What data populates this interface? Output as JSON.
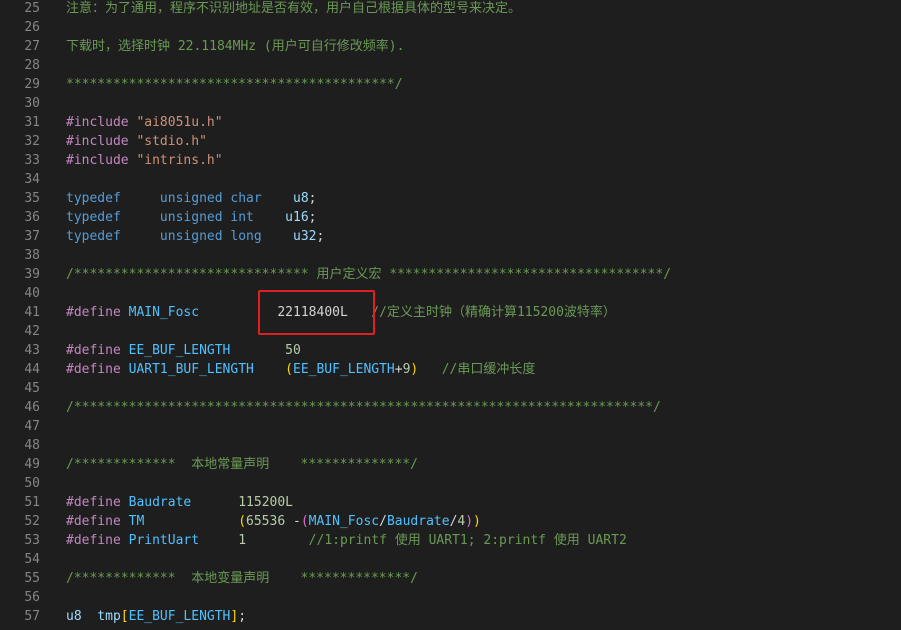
{
  "colors": {
    "background": "#1e1e1e",
    "highlight": "#e02020"
  },
  "lines": [
    {
      "n": "25",
      "tokens": [
        {
          "t": "注意：为了通用，程序不识别地址是否有效，用户自己根据具体的型号来决定。",
          "c": "comment"
        }
      ]
    },
    {
      "n": "26",
      "tokens": []
    },
    {
      "n": "27",
      "tokens": [
        {
          "t": "下载时，选择时钟 22.1184MHz (用户可自行修改频率).",
          "c": "comment"
        }
      ]
    },
    {
      "n": "28",
      "tokens": []
    },
    {
      "n": "29",
      "tokens": [
        {
          "t": "******************************************/",
          "c": "comment"
        }
      ]
    },
    {
      "n": "30",
      "tokens": []
    },
    {
      "n": "31",
      "tokens": [
        {
          "t": "#include",
          "c": "kw"
        },
        {
          "t": " ",
          "c": "plain"
        },
        {
          "t": "\"ai8051u.h\"",
          "c": "str"
        }
      ]
    },
    {
      "n": "32",
      "tokens": [
        {
          "t": "#include",
          "c": "kw"
        },
        {
          "t": " ",
          "c": "plain"
        },
        {
          "t": "\"stdio.h\"",
          "c": "str"
        }
      ]
    },
    {
      "n": "33",
      "tokens": [
        {
          "t": "#include",
          "c": "kw"
        },
        {
          "t": " ",
          "c": "plain"
        },
        {
          "t": "\"intrins.h\"",
          "c": "str"
        }
      ]
    },
    {
      "n": "34",
      "tokens": []
    },
    {
      "n": "35",
      "tokens": [
        {
          "t": "typedef",
          "c": "type"
        },
        {
          "t": "     unsigned char",
          "c": "type"
        },
        {
          "t": "    u8",
          "c": "ident"
        },
        {
          "t": ";",
          "c": "plain"
        }
      ]
    },
    {
      "n": "36",
      "tokens": [
        {
          "t": "typedef",
          "c": "type"
        },
        {
          "t": "     unsigned int",
          "c": "type"
        },
        {
          "t": "    u16",
          "c": "ident"
        },
        {
          "t": ";",
          "c": "plain"
        }
      ]
    },
    {
      "n": "37",
      "tokens": [
        {
          "t": "typedef",
          "c": "type"
        },
        {
          "t": "     unsigned long",
          "c": "type"
        },
        {
          "t": "    u32",
          "c": "ident"
        },
        {
          "t": ";",
          "c": "plain"
        }
      ]
    },
    {
      "n": "38",
      "tokens": []
    },
    {
      "n": "39",
      "tokens": [
        {
          "t": "/****************************** 用户定义宏 ***********************************/",
          "c": "comment"
        }
      ]
    },
    {
      "n": "40",
      "tokens": []
    },
    {
      "n": "41",
      "tokens": [
        {
          "t": "#define",
          "c": "kw"
        },
        {
          "t": " MAIN_Fosc",
          "c": "macro"
        },
        {
          "t": "          ",
          "c": "plain"
        },
        {
          "t": "22118400L",
          "c": "plain"
        },
        {
          "t": "   //定义主时钟（精确计算115200波特率）",
          "c": "comment"
        }
      ]
    },
    {
      "n": "42",
      "tokens": []
    },
    {
      "n": "43",
      "tokens": [
        {
          "t": "#define",
          "c": "kw"
        },
        {
          "t": " EE_BUF_LENGTH",
          "c": "macro"
        },
        {
          "t": "       ",
          "c": "plain"
        },
        {
          "t": "50",
          "c": "num"
        }
      ]
    },
    {
      "n": "44",
      "tokens": [
        {
          "t": "#define",
          "c": "kw"
        },
        {
          "t": " UART1_BUF_LENGTH",
          "c": "macro"
        },
        {
          "t": "    ",
          "c": "plain"
        },
        {
          "t": "(",
          "c": "paren"
        },
        {
          "t": "EE_BUF_LENGTH",
          "c": "macro"
        },
        {
          "t": "+",
          "c": "plain"
        },
        {
          "t": "9",
          "c": "num"
        },
        {
          "t": ")",
          "c": "paren"
        },
        {
          "t": "   //串口缓冲长度",
          "c": "comment"
        }
      ]
    },
    {
      "n": "45",
      "tokens": []
    },
    {
      "n": "46",
      "tokens": [
        {
          "t": "/**************************************************************************/",
          "c": "comment"
        }
      ]
    },
    {
      "n": "47",
      "tokens": []
    },
    {
      "n": "48",
      "tokens": []
    },
    {
      "n": "49",
      "tokens": [
        {
          "t": "/*************  本地常量声明    **************/",
          "c": "comment"
        }
      ]
    },
    {
      "n": "50",
      "tokens": []
    },
    {
      "n": "51",
      "tokens": [
        {
          "t": "#define",
          "c": "kw"
        },
        {
          "t": " Baudrate",
          "c": "macro"
        },
        {
          "t": "      ",
          "c": "plain"
        },
        {
          "t": "115200L",
          "c": "num"
        }
      ]
    },
    {
      "n": "52",
      "tokens": [
        {
          "t": "#define",
          "c": "kw"
        },
        {
          "t": " TM",
          "c": "macro"
        },
        {
          "t": "            ",
          "c": "plain"
        },
        {
          "t": "(",
          "c": "paren"
        },
        {
          "t": "65536",
          "c": "num"
        },
        {
          "t": " -",
          "c": "plain"
        },
        {
          "t": "(",
          "c": "paren2"
        },
        {
          "t": "MAIN_Fosc",
          "c": "macro"
        },
        {
          "t": "/",
          "c": "plain"
        },
        {
          "t": "Baudrate",
          "c": "macro"
        },
        {
          "t": "/",
          "c": "plain"
        },
        {
          "t": "4",
          "c": "num"
        },
        {
          "t": ")",
          "c": "paren2"
        },
        {
          "t": ")",
          "c": "paren"
        }
      ]
    },
    {
      "n": "53",
      "tokens": [
        {
          "t": "#define",
          "c": "kw"
        },
        {
          "t": " PrintUart",
          "c": "macro"
        },
        {
          "t": "     ",
          "c": "plain"
        },
        {
          "t": "1",
          "c": "num"
        },
        {
          "t": "        //1:printf 使用 UART1; 2:printf 使用 UART2",
          "c": "comment"
        }
      ]
    },
    {
      "n": "54",
      "tokens": []
    },
    {
      "n": "55",
      "tokens": [
        {
          "t": "/*************  本地变量声明    **************/",
          "c": "comment"
        }
      ]
    },
    {
      "n": "56",
      "tokens": []
    },
    {
      "n": "57",
      "tokens": [
        {
          "t": "u8",
          "c": "ident"
        },
        {
          "t": "  tmp",
          "c": "ident"
        },
        {
          "t": "[",
          "c": "paren"
        },
        {
          "t": "EE_BUF_LENGTH",
          "c": "macro"
        },
        {
          "t": "]",
          "c": "paren"
        },
        {
          "t": ";",
          "c": "plain"
        }
      ]
    }
  ]
}
